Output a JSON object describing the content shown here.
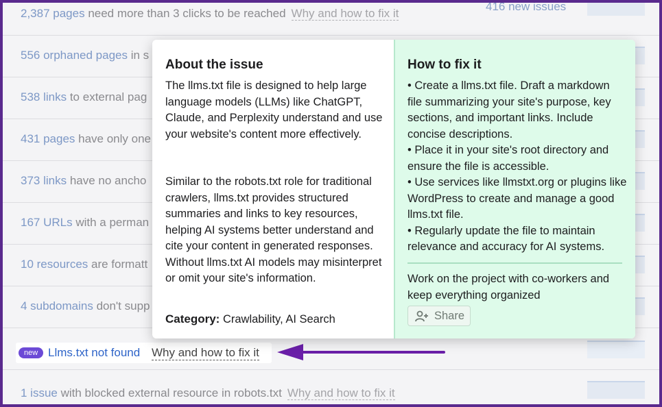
{
  "rows": [
    {
      "count": "2,387 pages",
      "text": " need more than 3 clicks to be reached",
      "fix": "Why and how to fix it",
      "issues": "416 new issues"
    },
    {
      "count": "556 orphaned pages",
      "text": " in s"
    },
    {
      "count": "538 links",
      "text": " to external pag"
    },
    {
      "count": "431 pages",
      "text": " have only one"
    },
    {
      "count": "373 links",
      "text": " have no ancho"
    },
    {
      "count": "167 URLs",
      "text": " with a perman"
    },
    {
      "count": "10 resources",
      "text": " are formatt"
    },
    {
      "count": "4 subdomains",
      "text": " don't supp"
    },
    {
      "count": "1 issue",
      "text": " with blocked external resource in robots.txt",
      "fix": "Why and how to fix it"
    }
  ],
  "highlight": {
    "badge": "new",
    "title": "Llms.txt not found",
    "fix": "Why and how to fix it"
  },
  "popover": {
    "about_title": "About the issue",
    "about_p1": "The llms.txt file is designed to help large language models (LLMs) like ChatGPT, Claude, and Perplexity understand and use your website's content more effectively.",
    "about_p2": "Similar to the robots.txt role for traditional crawlers, llms.txt provides structured summaries and links to key resources, helping AI systems better understand and cite your content in generated responses. Without llms.txt AI models may misinterpret or omit your site's information.",
    "category_label": "Category:",
    "category_value": " Crawlability, AI Search",
    "fix_title": "How to fix it",
    "fix_items": [
      "• Create a llms.txt file. Draft a markdown file summarizing your site's purpose, key sections, and important links. Include concise descriptions.",
      "• Place it in your site's root directory and ensure the file is accessible.",
      "• Use services like llmstxt.org or plugins like WordPress to create and manage a good llms.txt file.",
      "• Regularly update the file to maintain relevance and accuracy for AI systems."
    ],
    "cowork_text": "Work on the project with co-workers and keep everything organized",
    "share_label": "Share",
    "share_icon": "add-user-icon"
  },
  "colors": {
    "frame_border": "#5a2a8e",
    "link": "#2e64c8",
    "badge": "#6c4ad6",
    "arrow": "#6a1fa8",
    "fix_panel": "#defbea"
  }
}
